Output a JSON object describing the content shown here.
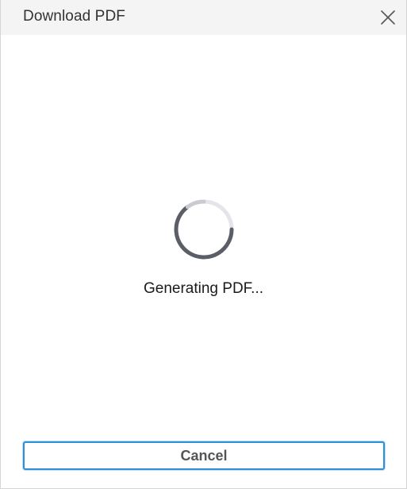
{
  "dialog": {
    "title": "Download PDF",
    "close_icon": "close-icon",
    "spinner_icon": "loading-spinner-icon",
    "status_text": "Generating PDF...",
    "cancel_label": "Cancel"
  },
  "colors": {
    "titlebar_bg": "#f4f4f4",
    "spinner": "#5b5e66",
    "button_border": "#2f8fd8",
    "button_text": "#555555"
  }
}
